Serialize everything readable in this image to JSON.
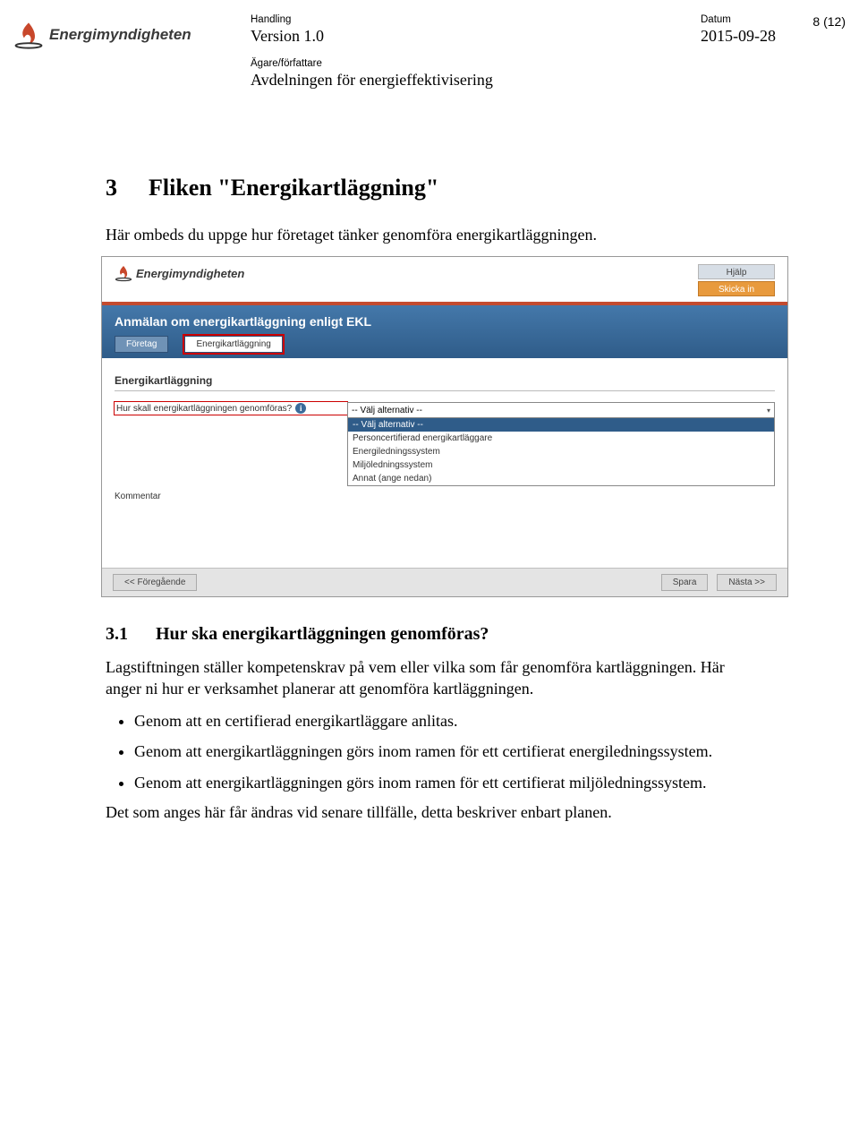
{
  "header": {
    "logo_text": "Energimyndigheten",
    "handling_label": "Handling",
    "version_value": "Version 1.0",
    "datum_label": "Datum",
    "datum_value": "2015-09-28",
    "page_number": "8 (12)",
    "owner_label": "Ägare/författare",
    "owner_value": "Avdelningen för energieffektivisering"
  },
  "section": {
    "num": "3",
    "title": "Fliken \"Energikartläggning\"",
    "intro": "Här ombeds du uppge hur företaget tänker genomföra energikartläggningen."
  },
  "screenshot": {
    "logo_text": "Energimyndigheten",
    "btn_help": "Hjälp",
    "btn_submit": "Skicka in",
    "banner_title": "Anmälan om energikartläggning enligt EKL",
    "tab_company": "Företag",
    "tab_mapping": "Energikartläggning",
    "section_title": "Energikartläggning",
    "question_label": "Hur skall energikartläggningen genomföras?",
    "comment_label": "Kommentar",
    "select_placeholder": "-- Välj alternativ --",
    "options": [
      "-- Välj alternativ --",
      "Personcertifierad energikartläggare",
      "Energiledningssystem",
      "Miljöledningssystem",
      "Annat (ange nedan)"
    ],
    "btn_prev": "<< Föregående",
    "btn_save": "Spara",
    "btn_next": "Nästa >>"
  },
  "subsection": {
    "num": "3.1",
    "title": "Hur ska energikartläggningen genomföras?",
    "p1": "Lagstiftningen ställer kompetenskrav på vem eller vilka som får genomföra kartläggningen. Här anger ni hur er verksamhet planerar att genomföra kartläggningen.",
    "bullets": [
      "Genom att en certifierad energikartläggare anlitas.",
      "Genom att energikartläggningen görs inom ramen för ett certifierat energiledningssystem.",
      "Genom att energikartläggningen görs inom ramen för ett certifierat miljöledningssystem."
    ],
    "closing": "Det som anges här får ändras vid senare tillfälle, detta beskriver enbart planen."
  }
}
